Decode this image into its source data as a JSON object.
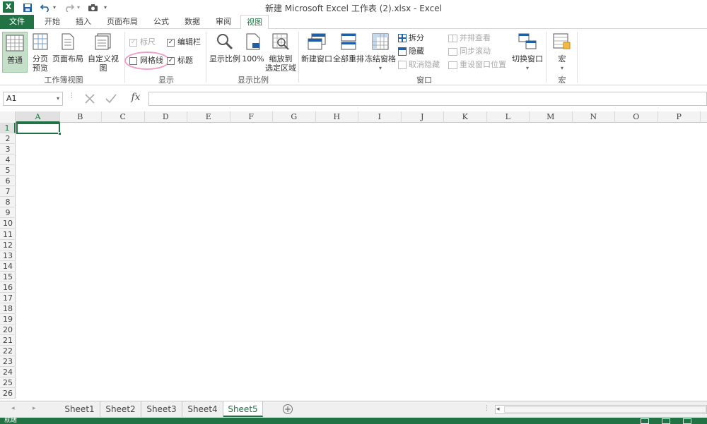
{
  "window": {
    "title": "新建 Microsoft Excel 工作表 (2).xlsx - Excel",
    "app_logo": "X"
  },
  "tabs": [
    {
      "id": "file",
      "label": "文件"
    },
    {
      "id": "home",
      "label": "开始"
    },
    {
      "id": "insert",
      "label": "插入"
    },
    {
      "id": "layout",
      "label": "页面布局"
    },
    {
      "id": "formulas",
      "label": "公式"
    },
    {
      "id": "data",
      "label": "数据"
    },
    {
      "id": "review",
      "label": "审阅"
    },
    {
      "id": "view",
      "label": "视图"
    }
  ],
  "ribbon": {
    "workbook_views": {
      "group_label": "工作簿视图",
      "normal": "普通",
      "page_break_1": "分页",
      "page_break_2": "预览",
      "page_layout": "页面布局",
      "custom_views": "自定义视图"
    },
    "show": {
      "group_label": "显示",
      "ruler": "标尺",
      "gridlines": "网格线",
      "formula_bar": "编辑栏",
      "headings": "标题",
      "ruler_checked": true,
      "gridlines_checked": false,
      "formula_bar_checked": true,
      "headings_checked": true
    },
    "zoom": {
      "group_label": "显示比例",
      "zoom": "显示比例",
      "hundred": "100%",
      "zoom_sel_1": "缩放到",
      "zoom_sel_2": "选定区域"
    },
    "window": {
      "group_label": "窗口",
      "new_window": "新建窗口",
      "arrange_all": "全部重排",
      "freeze_panes": "冻结窗格",
      "split": "拆分",
      "hide": "隐藏",
      "unhide": "取消隐藏",
      "side_by_side": "并排查看",
      "sync_scroll": "同步滚动",
      "reset_position": "重设窗口位置",
      "switch_windows": "切换窗口"
    },
    "macros": {
      "group_label": "宏",
      "macros": "宏"
    }
  },
  "formula_bar": {
    "name_box": "A1",
    "fx_label": "fx",
    "value": ""
  },
  "grid": {
    "columns": [
      "A",
      "B",
      "C",
      "D",
      "E",
      "F",
      "G",
      "H",
      "I",
      "J",
      "K",
      "L",
      "M",
      "N",
      "O",
      "P"
    ],
    "rows": [
      "1",
      "2",
      "3",
      "4",
      "5",
      "6",
      "7",
      "8",
      "9",
      "10",
      "11",
      "12",
      "13",
      "14",
      "15",
      "16",
      "17",
      "18",
      "19",
      "20",
      "21",
      "22",
      "23",
      "24",
      "25",
      "26"
    ],
    "active_cell": "A1"
  },
  "sheets": [
    "Sheet1",
    "Sheet2",
    "Sheet3",
    "Sheet4",
    "Sheet5"
  ],
  "active_sheet": "Sheet5",
  "status": {
    "ready": "就绪"
  },
  "colors": {
    "accent": "#217346",
    "highlight_circle": "#f0a0c8"
  }
}
